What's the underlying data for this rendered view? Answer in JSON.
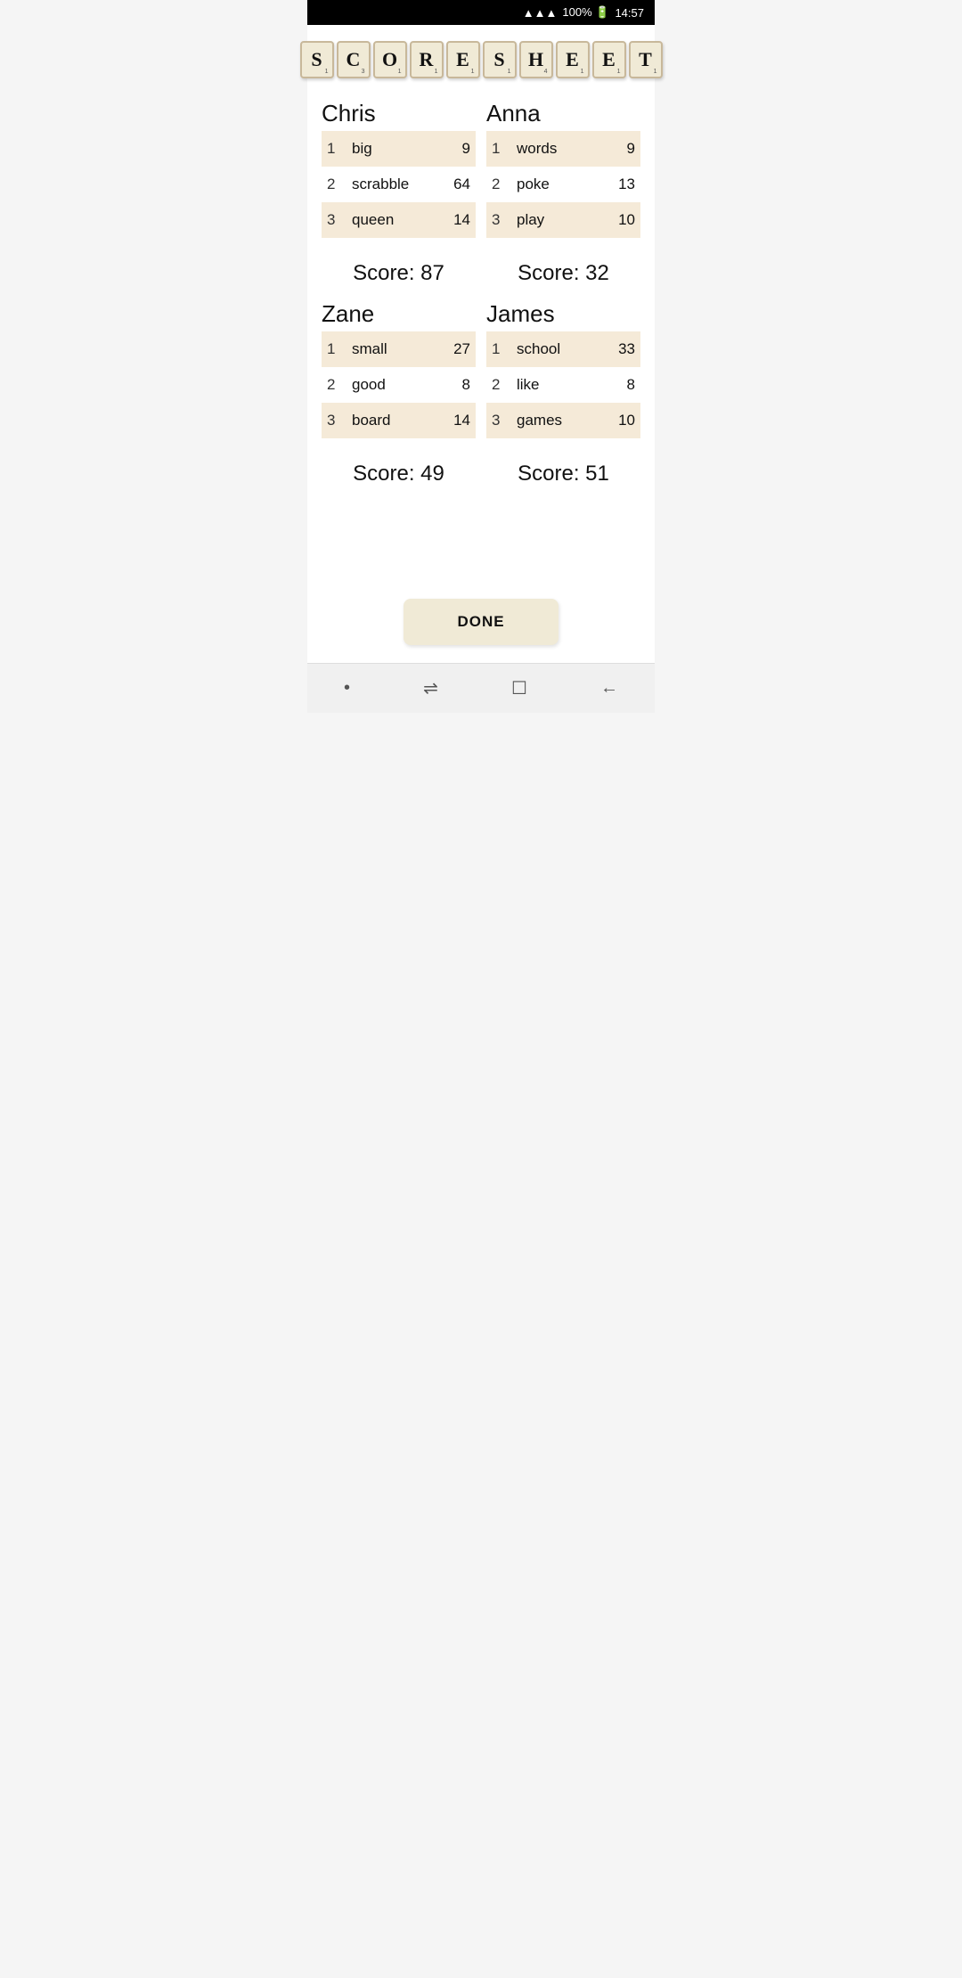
{
  "statusBar": {
    "signal": "▲▲▲▲",
    "battery": "100% 🔋",
    "time": "14:57"
  },
  "titleTiles": [
    {
      "letter": "S",
      "num": "1"
    },
    {
      "letter": "C",
      "num": "3"
    },
    {
      "letter": "O",
      "num": "1"
    },
    {
      "letter": "R",
      "num": "1"
    },
    {
      "letter": "E",
      "num": "1"
    },
    {
      "letter": "S",
      "num": "1"
    },
    {
      "letter": "H",
      "num": "4"
    },
    {
      "letter": "E",
      "num": "1"
    },
    {
      "letter": "E",
      "num": "1"
    },
    {
      "letter": "T",
      "num": "1"
    }
  ],
  "players": [
    {
      "name": "Chris",
      "plays": [
        {
          "num": "1",
          "word": "big",
          "pts": "9"
        },
        {
          "num": "2",
          "word": "scrabble",
          "pts": "64"
        },
        {
          "num": "3",
          "word": "queen",
          "pts": "14"
        }
      ],
      "scoreLabel": "Score: 87"
    },
    {
      "name": "Anna",
      "plays": [
        {
          "num": "1",
          "word": "words",
          "pts": "9"
        },
        {
          "num": "2",
          "word": "poke",
          "pts": "13"
        },
        {
          "num": "3",
          "word": "play",
          "pts": "10"
        }
      ],
      "scoreLabel": "Score: 32"
    },
    {
      "name": "Zane",
      "plays": [
        {
          "num": "1",
          "word": "small",
          "pts": "27"
        },
        {
          "num": "2",
          "word": "good",
          "pts": "8"
        },
        {
          "num": "3",
          "word": "board",
          "pts": "14"
        }
      ],
      "scoreLabel": "Score: 49"
    },
    {
      "name": "James",
      "plays": [
        {
          "num": "1",
          "word": "school",
          "pts": "33"
        },
        {
          "num": "2",
          "word": "like",
          "pts": "8"
        },
        {
          "num": "3",
          "word": "games",
          "pts": "10"
        }
      ],
      "scoreLabel": "Score: 51"
    }
  ],
  "doneButton": "DONE",
  "nav": {
    "dot": "•",
    "lines": "⇌",
    "square": "☐",
    "back": "←"
  }
}
